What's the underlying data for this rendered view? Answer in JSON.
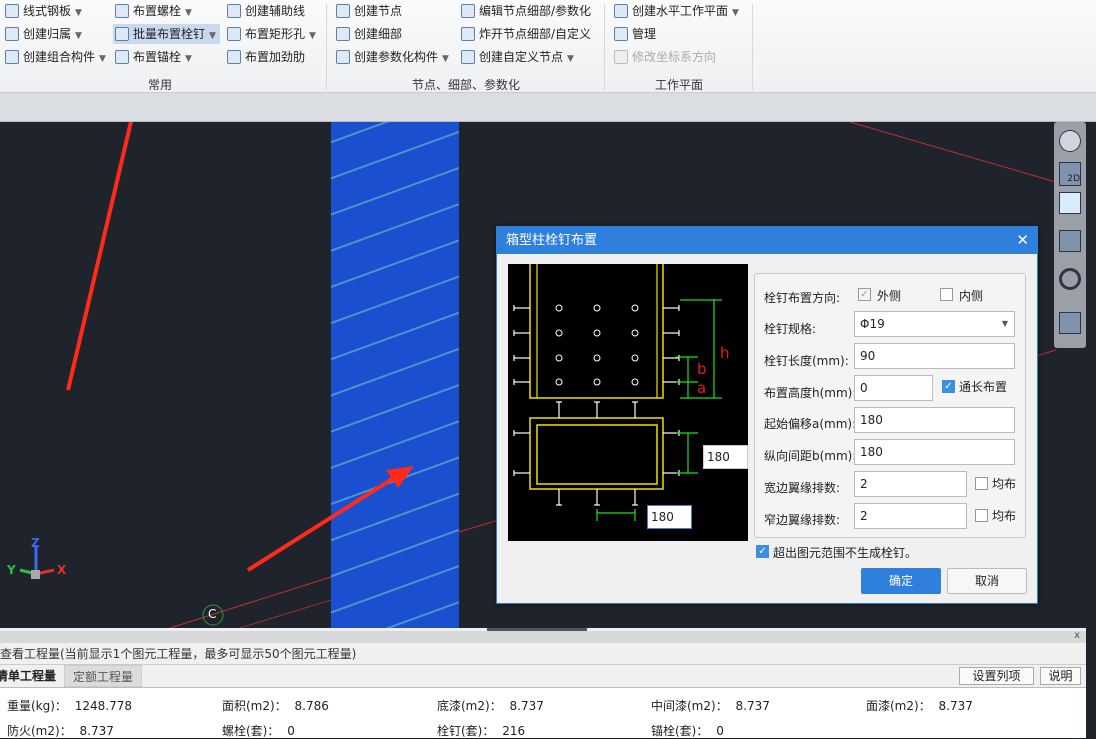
{
  "ribbon": {
    "col1": [
      {
        "label": "线式钢板",
        "dd": true
      },
      {
        "label": "创建归属",
        "dd": true
      },
      {
        "label": "创建组合构件",
        "dd": true
      }
    ],
    "col2": [
      {
        "label": "布置螺栓",
        "dd": true
      },
      {
        "label": "批量布置栓钉",
        "dd": true,
        "selected": true
      },
      {
        "label": "布置锚栓",
        "dd": true
      }
    ],
    "col3": [
      {
        "label": "创建辅助线"
      },
      {
        "label": "布置矩形孔",
        "dd": true
      },
      {
        "label": "布置加劲肋"
      }
    ],
    "col4": [
      {
        "label": "创建节点"
      },
      {
        "label": "创建细部"
      },
      {
        "label": "创建参数化构件",
        "dd": true
      }
    ],
    "col5": [
      {
        "label": "编辑节点细部/参数化"
      },
      {
        "label": "炸开节点细部/自定义"
      },
      {
        "label": "创建自定义节点",
        "dd": true
      }
    ],
    "col6": [
      {
        "label": "创建水平工作平面",
        "dd": true
      },
      {
        "label": "管理"
      },
      {
        "label": "修改坐标系方向",
        "disabled": true
      }
    ],
    "groups": [
      "常用",
      "节点、细部、参数化",
      "工作平面"
    ]
  },
  "viewport": {
    "axis_labels": {
      "z": "Z",
      "y": "Y",
      "x": "X"
    },
    "grid_label": "C",
    "column_color": "#1a4fd0",
    "arrow_color": "#ff2a1a"
  },
  "navbar": {
    "icons": [
      "orbit-icon",
      "view-2d-icon",
      "wireframe-cube-icon",
      "solid-cube-icon",
      "rotate-icon",
      "checklist-icon"
    ],
    "view_2d_label": "2D"
  },
  "dialog": {
    "title": "箱型柱栓钉布置",
    "diagram": {
      "labels": {
        "h": "h",
        "b": "b",
        "a": "a"
      },
      "spacing_right": "180",
      "spacing_bottom": "180"
    },
    "direction_label": "栓钉布置方向:",
    "outer": {
      "label": "外侧",
      "checked": true
    },
    "inner": {
      "label": "内侧",
      "checked": false
    },
    "spec_label": "栓钉规格:",
    "spec_value": "Φ19",
    "length_label": "栓钉长度(mm):",
    "length_value": "90",
    "height_label": "布置高度h(mm):",
    "height_value": "0",
    "full_length": {
      "label": "通长布置",
      "checked": true
    },
    "offset_label": "起始偏移a(mm):",
    "offset_value": "180",
    "spacing_label": "纵向间距b(mm):",
    "spacing_value": "180",
    "wide_rows_label": "宽边翼缘排数:",
    "wide_rows_value": "2",
    "wide_even": {
      "label": "均布",
      "checked": false
    },
    "narrow_rows_label": "窄边翼缘排数:",
    "narrow_rows_value": "2",
    "narrow_even": {
      "label": "均布",
      "checked": false
    },
    "skip_outside": {
      "label": "超出图元范围不生成栓钉。",
      "checked": true
    },
    "ok": "确定",
    "cancel": "取消"
  },
  "bottom": {
    "header": "查看工程量(当前显示1个图元工程量，最多可显示50个图元工程量)",
    "close": "x",
    "tabs": [
      {
        "label": "清单工程量",
        "active": true
      },
      {
        "label": "定额工程量",
        "active": false
      }
    ],
    "set_columns": "设置列项",
    "help": "说明",
    "row1": [
      {
        "k": "重量(kg)：",
        "v": "1248.778"
      },
      {
        "k": "面积(m2)：",
        "v": "8.786"
      },
      {
        "k": "底漆(m2)：",
        "v": "8.737"
      },
      {
        "k": "中间漆(m2)：",
        "v": "8.737"
      },
      {
        "k": "面漆(m2)：",
        "v": "8.737"
      }
    ],
    "row2": [
      {
        "k": "防火(m2)：",
        "v": "8.737"
      },
      {
        "k": "螺栓(套)：",
        "v": "0"
      },
      {
        "k": "栓钉(套)：",
        "v": "216"
      },
      {
        "k": "锚栓(套)：",
        "v": "0"
      }
    ]
  }
}
